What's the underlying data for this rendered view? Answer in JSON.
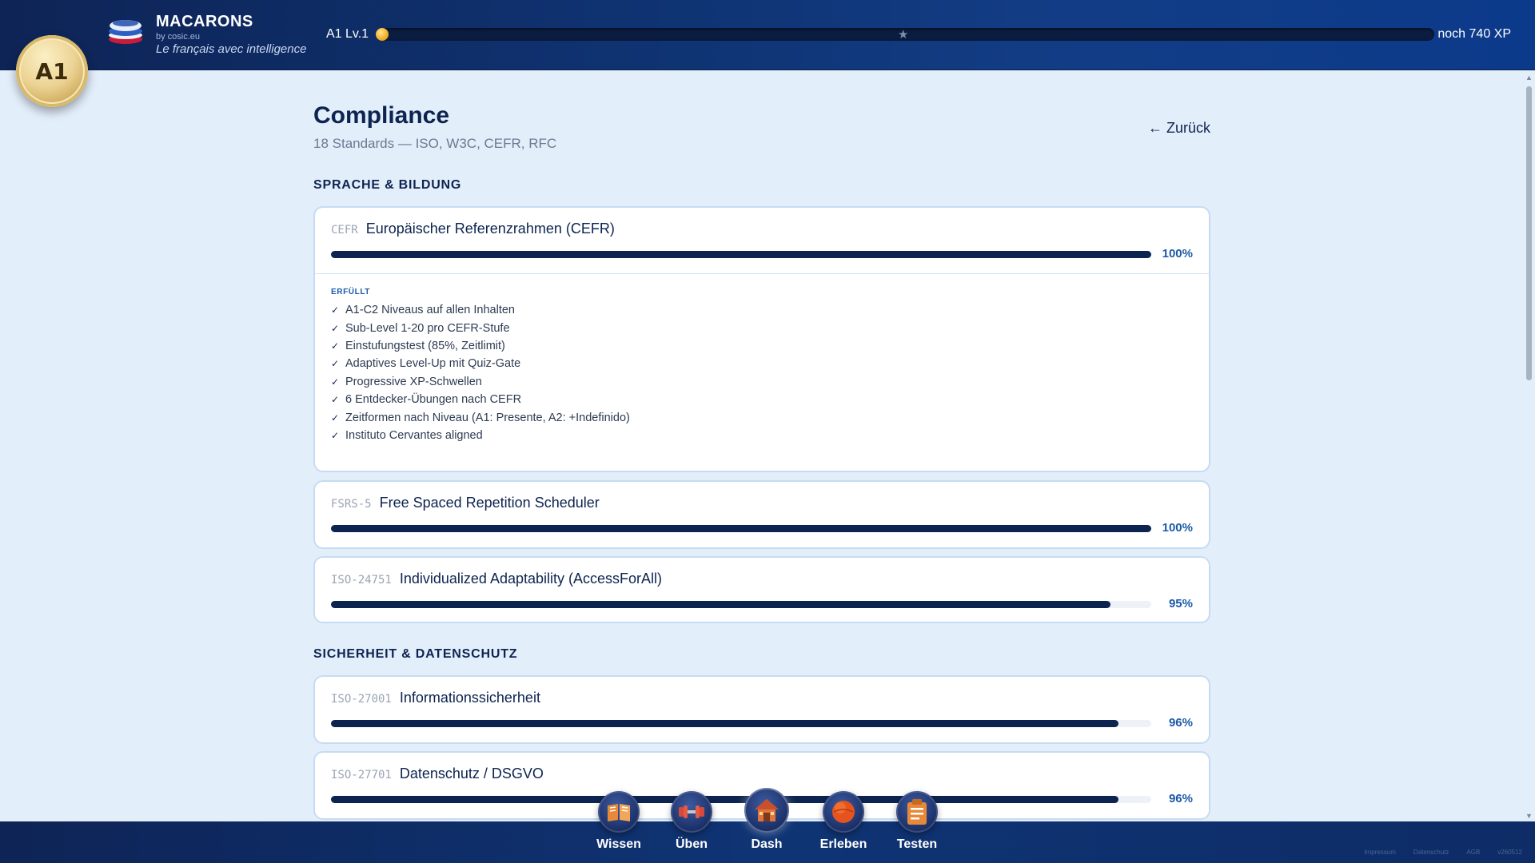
{
  "header": {
    "level_badge": "A1",
    "brand_name": "MACARONS",
    "brand_by": "by cosic.eu",
    "tagline": "Le français avec intelligence",
    "xp_level": "A1 Lv.1",
    "xp_remaining": "noch 740 XP"
  },
  "page": {
    "title": "Compliance",
    "subtitle": "18 Standards — ISO, W3C, CEFR, RFC",
    "back_label": "← Zurück"
  },
  "sections": [
    {
      "title": "SPRACHE & BILDUNG",
      "cards": [
        {
          "code": "CEFR",
          "name": "Europäischer Referenzrahmen (CEFR)",
          "progress": 100,
          "pct_label": "100%",
          "fulfilled_label": "ERFÜLLT",
          "items": [
            "A1-C2 Niveaus auf allen Inhalten",
            "Sub-Level 1-20 pro CEFR-Stufe",
            "Einstufungstest (85%, Zeitlimit)",
            "Adaptives Level-Up mit Quiz-Gate",
            "Progressive XP-Schwellen",
            "6 Entdecker-Übungen nach CEFR",
            "Zeitformen nach Niveau (A1: Presente, A2: +Indefinido)",
            "Instituto Cervantes aligned"
          ]
        },
        {
          "code": "FSRS-5",
          "name": "Free Spaced Repetition Scheduler",
          "progress": 100,
          "pct_label": "100%"
        },
        {
          "code": "ISO-24751",
          "name": "Individualized Adaptability (AccessForAll)",
          "progress": 95,
          "pct_label": "95%"
        }
      ]
    },
    {
      "title": "SICHERHEIT & DATENSCHUTZ",
      "cards": [
        {
          "code": "ISO-27001",
          "name": "Informationssicherheit",
          "progress": 96,
          "pct_label": "96%"
        },
        {
          "code": "ISO-27701",
          "name": "Datenschutz / DSGVO",
          "progress": 96,
          "pct_label": "96%"
        }
      ]
    }
  ],
  "nav": [
    {
      "label": "Wissen",
      "icon": "book-icon",
      "active": false
    },
    {
      "label": "Üben",
      "icon": "dumbbell-icon",
      "active": false
    },
    {
      "label": "Dash",
      "icon": "house-icon",
      "active": true
    },
    {
      "label": "Erleben",
      "icon": "globe-icon",
      "active": false
    },
    {
      "label": "Testen",
      "icon": "clipboard-icon",
      "active": false
    }
  ],
  "footer": {
    "links": [
      "Impressum",
      "Datenschutz",
      "AGB",
      "v260512"
    ]
  },
  "colors": {
    "header_bg": "#0f3474",
    "accent": "#0d2450",
    "pct_text": "#1a5aa8",
    "page_bg": "#e3eefb",
    "gold": "#e4c679"
  }
}
